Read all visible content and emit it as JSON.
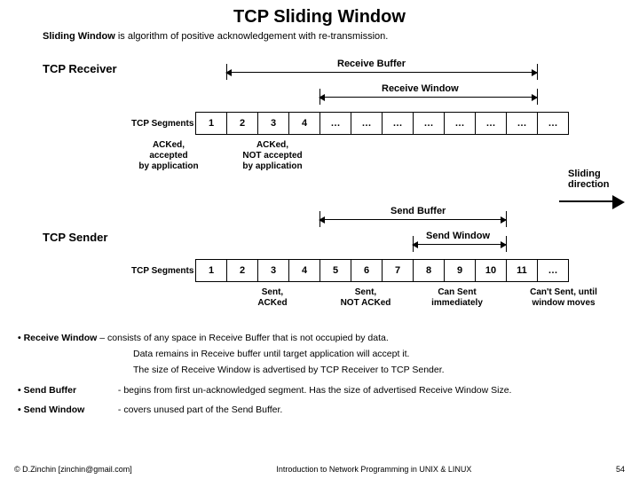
{
  "title": "TCP Sliding Window",
  "subtitle_pre": "Sliding Window",
  "subtitle_post": " is algorithm of positive acknowledgement with re-transmission.",
  "receiver": {
    "label": "TCP Receiver",
    "buffer_label": "Receive Buffer",
    "window_label": "Receive Window",
    "seg_label": "TCP Segments",
    "cells": [
      "1",
      "2",
      "3",
      "4",
      "…",
      "…",
      "…",
      "…",
      "…",
      "…",
      "…",
      "…"
    ],
    "annot_left": "ACKed,\naccepted\nby application",
    "annot_mid": "ACKed,\nNOT accepted\nby application"
  },
  "sliding_dir": "Sliding\ndirection",
  "sender": {
    "label": "TCP Sender",
    "buffer_label": "Send Buffer",
    "window_label": "Send Window",
    "seg_label": "TCP Segments",
    "cells": [
      "1",
      "2",
      "3",
      "4",
      "5",
      "6",
      "7",
      "8",
      "9",
      "10",
      "11",
      "…"
    ],
    "annot_a": "Sent,\nACKed",
    "annot_b": "Sent,\nNOT ACKed",
    "annot_c": "Can Sent\nimmediately",
    "annot_d": "Can't Sent, until\nwindow moves"
  },
  "bullets": {
    "b1_head": "• Receive Window",
    "b1_l1": " – consists of any space in Receive Buffer that is not occupied by data.",
    "b1_l2": "Data remains in Receive buffer until target application will accept it.",
    "b1_l3": "The size of Receive Window is advertised by TCP Receiver to TCP Sender.",
    "b2_head": "• Send Buffer",
    "b2_body": "-  begins from first un-acknowledged segment. Has the size of advertised Receive Window Size.",
    "b3_head": "• Send Window",
    "b3_body": "-  covers unused part of the Send Buffer."
  },
  "footer": {
    "left": "© D.Zinchin [zinchin@gmail.com]",
    "center": "Introduction to Network Programming in UNIX & LINUX",
    "right": "54"
  }
}
